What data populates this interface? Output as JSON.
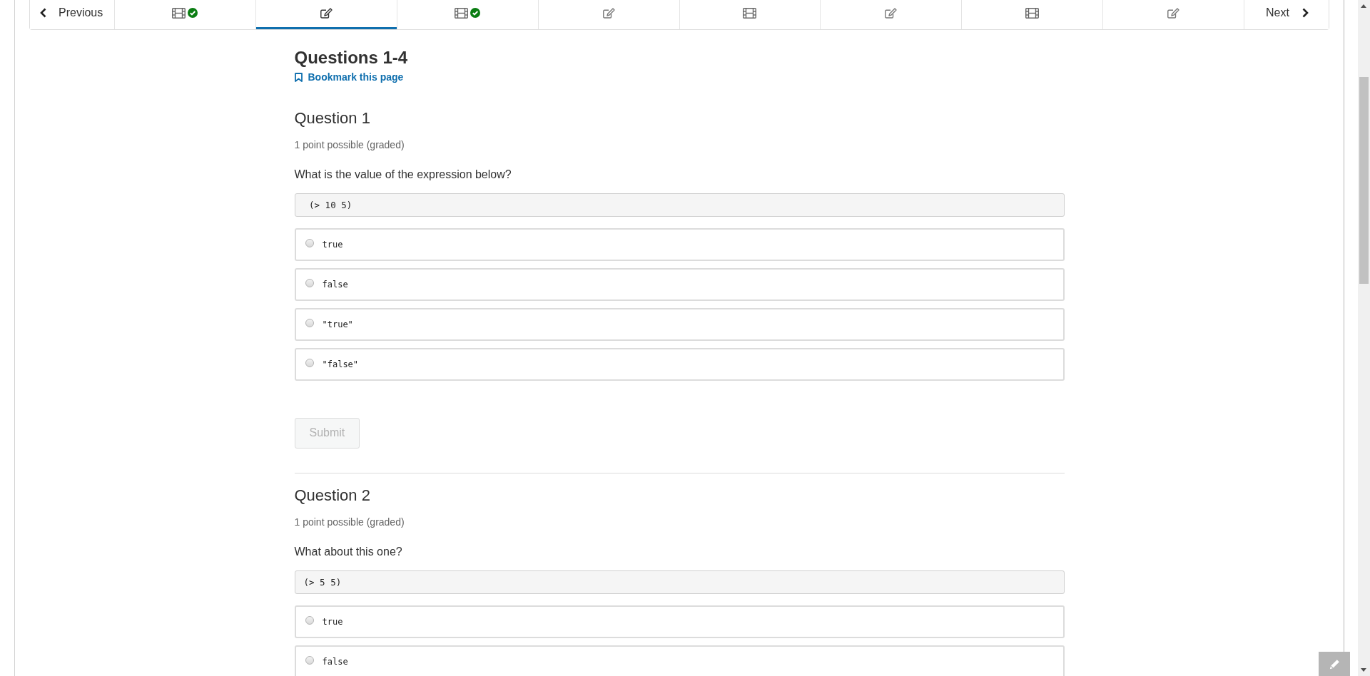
{
  "nav": {
    "previous": {
      "label": "Previous"
    },
    "tabs": [
      {
        "kind": "video",
        "complete": true,
        "selected": false
      },
      {
        "kind": "problem",
        "complete": false,
        "selected": true
      },
      {
        "kind": "video",
        "complete": true,
        "selected": false
      },
      {
        "kind": "problem",
        "complete": false,
        "selected": false
      },
      {
        "kind": "video",
        "complete": false,
        "selected": false
      },
      {
        "kind": "problem",
        "complete": false,
        "selected": false
      },
      {
        "kind": "video",
        "complete": false,
        "selected": false
      },
      {
        "kind": "problem",
        "complete": false,
        "selected": false
      }
    ],
    "next": {
      "label": "Next"
    }
  },
  "unit": {
    "title": "Questions 1-4",
    "bookmark": {
      "label": "Bookmark this page"
    }
  },
  "problems": [
    {
      "title": "Question 1",
      "points": "1 point possible (graded)",
      "prompt": "What is the value of the expression below?",
      "code": " (> 10 5)",
      "options": [
        {
          "label": "true",
          "selected": false
        },
        {
          "label": "false",
          "selected": false
        },
        {
          "label": "\"true\"",
          "selected": false
        },
        {
          "label": "\"false\"",
          "selected": false
        }
      ],
      "submit": {
        "label": "Submit",
        "disabled": true
      }
    },
    {
      "title": "Question 2",
      "points": "1 point possible (graded)",
      "prompt": "What about this one?",
      "code": "(> 5 5)",
      "options": [
        {
          "label": "true",
          "selected": false
        },
        {
          "label": "false",
          "selected": false
        }
      ]
    }
  ]
}
